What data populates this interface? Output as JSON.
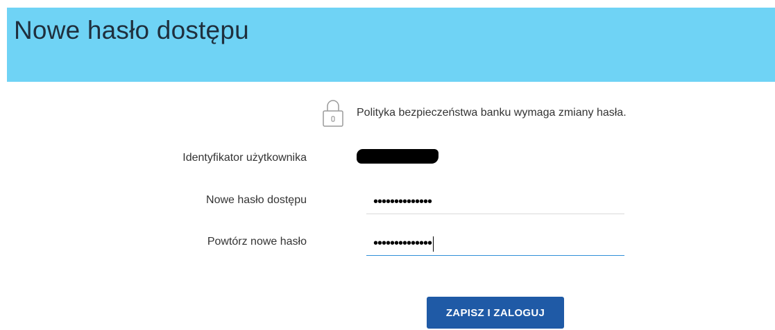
{
  "header": {
    "title": "Nowe hasło dostępu"
  },
  "notice": {
    "icon": "lock-icon",
    "text": "Polityka bezpieczeństwa banku wymaga zmiany hasła."
  },
  "form": {
    "user_id_label": "Identyfikator użytkownika",
    "user_id_value_redacted": true,
    "new_password_label": "Nowe hasło dostępu",
    "new_password_value": "••••••••••••••",
    "repeat_password_label": "Powtórz nowe hasło",
    "repeat_password_value": "••••••••••••••",
    "submit_label": "ZAPISZ I ZALOGUJ"
  },
  "colors": {
    "header_bg": "#6fd3f5",
    "button_bg": "#1f5aa6",
    "focus_underline": "#2f8fd8"
  }
}
